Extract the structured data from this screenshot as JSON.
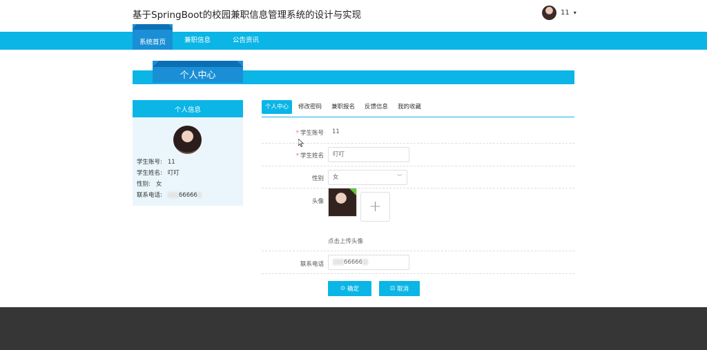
{
  "header": {
    "title": "基于SpringBoot的校园兼职信息管理系统的设计与实现",
    "username": "11"
  },
  "nav": {
    "items": [
      {
        "label": "系统首页"
      },
      {
        "label": "兼职信息"
      },
      {
        "label": "公告资讯"
      }
    ]
  },
  "banner": {
    "title": "个人中心"
  },
  "sidebar": {
    "title": "个人信息",
    "fields": [
      {
        "label": "学生账号:",
        "value": "11"
      },
      {
        "label": "学生姓名:",
        "value": "叮叮"
      },
      {
        "label": "性别:",
        "value": "女"
      },
      {
        "label": "联系电话:",
        "value": "66666"
      }
    ]
  },
  "tabs": [
    {
      "label": "个人中心"
    },
    {
      "label": "修改密码"
    },
    {
      "label": "兼职报名"
    },
    {
      "label": "反馈信息"
    },
    {
      "label": "我的收藏"
    }
  ],
  "form": {
    "account_label": "学生账号",
    "account_value": "11",
    "name_label": "学生姓名",
    "name_value": "叮叮",
    "gender_label": "性别",
    "gender_value": "女",
    "avatar_label": "头像",
    "upload_plus": "+",
    "upload_tip": "点击上传头像",
    "phone_label": "联系电话",
    "phone_value": "66666",
    "required_mark": "*",
    "confirm_label": "确定",
    "cancel_label": "取消"
  },
  "colors": {
    "primary": "#0bb5e6",
    "active": "#1b8fd6",
    "footer": "#363636"
  }
}
